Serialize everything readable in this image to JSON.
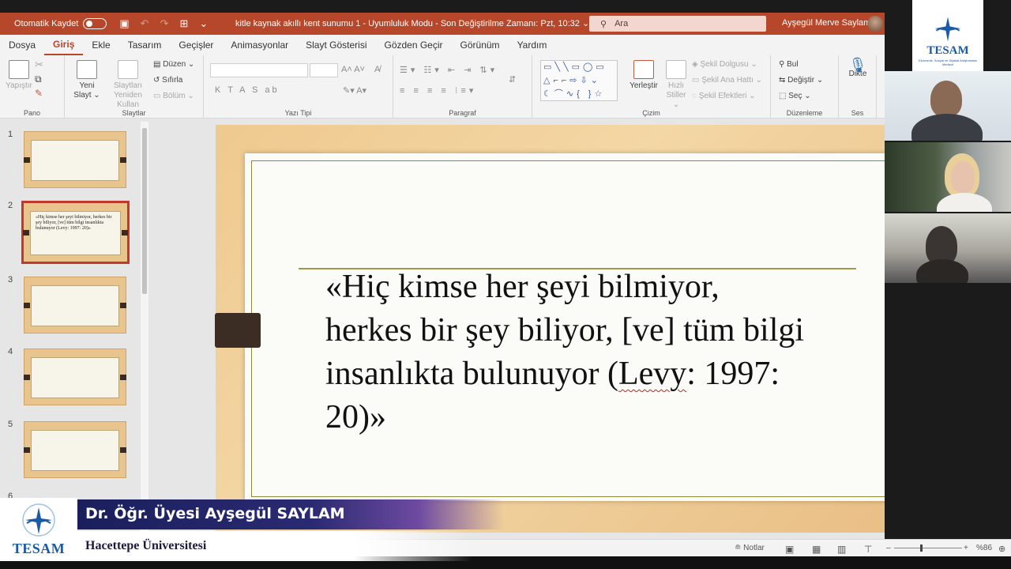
{
  "titlebar": {
    "autosave_label": "Otomatik Kaydet",
    "doc_title": "kitle kaynak akıllı kent sunumu 1  -  Uyumluluk Modu  -  Son Değiştirilme Zamanı: Pzt, 10:32  ⌄",
    "search_placeholder": "Ara",
    "user_name": "Ayşegül Merve Saylam"
  },
  "menu": {
    "tabs": [
      "Dosya",
      "Giriş",
      "Ekle",
      "Tasarım",
      "Geçişler",
      "Animasyonlar",
      "Slayt Gösterisi",
      "Gözden Geçir",
      "Görünüm",
      "Yardım"
    ],
    "active": "Giriş"
  },
  "ribbon": {
    "pano": {
      "label": "Pano",
      "paste": "Yapıştır"
    },
    "slaytlar": {
      "label": "Slaytlar",
      "new_slide": "Yeni Slayt ⌄",
      "reuse": "Slaytları Yeniden Kullan",
      "layout": "Düzen ⌄",
      "reset": "Sıfırla",
      "section": "Bölüm ⌄"
    },
    "yazi_tipi": {
      "label": "Yazı Tipi",
      "buttons": "K  T  A  S  ab"
    },
    "paragraf": {
      "label": "Paragraf"
    },
    "cizim": {
      "label": "Çizim",
      "arrange": "Yerleştir",
      "quick_styles": "Hızlı Stiller ⌄",
      "fill": "Şekil Dolgusu ⌄",
      "outline": "Şekil Ana Hattı ⌄",
      "effects": "Şekil Efektleri ⌄"
    },
    "duzenleme": {
      "label": "Düzenleme",
      "find": "Bul",
      "replace": "Değiştir  ⌄",
      "select": "Seç ⌄"
    },
    "ses": {
      "label": "Ses",
      "dictate": "Dikte"
    }
  },
  "thumbnails": [
    {
      "num": "1",
      "text": ""
    },
    {
      "num": "2",
      "text": "«Hiç kimse her şeyi bilmiyor, herkes bir şey biliyor, [ve] tüm bilgi insanlıkta bulunuyor (Levy: 1997: 20)»"
    },
    {
      "num": "3",
      "text": ""
    },
    {
      "num": "4",
      "text": ""
    },
    {
      "num": "5",
      "text": ""
    },
    {
      "num": "6",
      "text": ""
    }
  ],
  "slide": {
    "quote_line1": "«Hiç kimse her şeyi bilmiyor,",
    "quote_line2": "herkes bir şey biliyor, [ve] tüm bilgi",
    "quote_line3_pre": "insanlıkta bulunuyor (",
    "quote_line3_word": "Levy",
    "quote_line3_post": ": 1997:",
    "quote_line4": "20)»"
  },
  "statusbar": {
    "notes": "Notlar",
    "zoom": "%86"
  },
  "lower_third": {
    "name": "Dr. Öğr. Üyesi Ayşegül SAYLAM",
    "institution": "Hacettepe Üniversitesi",
    "logo_text": "TESAM"
  },
  "video_logo": {
    "text": "TESAM",
    "sub": "Ekonomik, Sosyal ve Siyasal Araştırmalar Merkezi"
  },
  "colors": {
    "accent": "#b7472a",
    "slide_bg": "#efc98e",
    "lower_third": "#1a1f5c"
  }
}
